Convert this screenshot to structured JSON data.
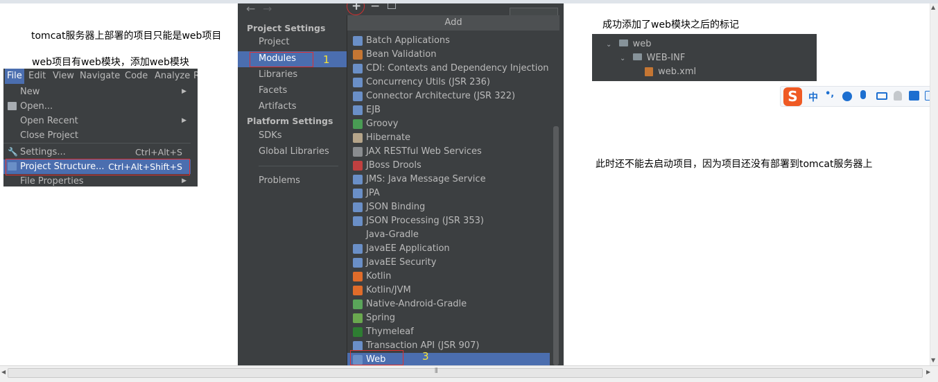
{
  "notes": {
    "line1": "tomcat服务器上部署的项目只能是web项目",
    "line2": "web项目有web模块，添加web模块",
    "right_title": "成功添加了web模块之后的标记",
    "right_note": "此时还不能去启动项目，因为项目还没有部署到tomcat服务器上"
  },
  "menubar": {
    "items": [
      "File",
      "Edit",
      "View",
      "Navigate",
      "Code",
      "Analyze",
      "R"
    ]
  },
  "file_menu": {
    "items": [
      {
        "label": "New",
        "shortcut": "",
        "submenu": true
      },
      {
        "label": "Open...",
        "shortcut": "",
        "submenu": false
      },
      {
        "label": "Open Recent",
        "shortcut": "",
        "submenu": true
      },
      {
        "label": "Close Project",
        "shortcut": "",
        "submenu": false
      },
      {
        "label": "Settings...",
        "shortcut": "Ctrl+Alt+S",
        "submenu": false
      },
      {
        "label": "Project Structure...",
        "shortcut": "Ctrl+Alt+Shift+S",
        "submenu": false
      },
      {
        "label": "File Properties",
        "shortcut": "",
        "submenu": true
      }
    ]
  },
  "project_structure": {
    "project_settings_header": "Project Settings",
    "project_settings": [
      "Project",
      "Modules",
      "Libraries",
      "Facets",
      "Artifacts"
    ],
    "platform_settings_header": "Platform Settings",
    "platform_settings": [
      "SDKs",
      "Global Libraries"
    ],
    "problems": "Problems",
    "add_popup_title": "Add",
    "add_items": [
      "Batch Applications",
      "Bean Validation",
      "CDI: Contexts and Dependency Injection",
      "Concurrency Utils (JSR 236)",
      "Connector Architecture (JSR 322)",
      "EJB",
      "Groovy",
      "Hibernate",
      "JAX RESTful Web Services",
      "JBoss Drools",
      "JMS: Java Message Service",
      "JPA",
      "JSON Binding",
      "JSON Processing (JSR 353)",
      "Java-Gradle",
      "JavaEE Application",
      "JavaEE Security",
      "Kotlin",
      "Kotlin/JVM",
      "Native-Android-Gradle",
      "Spring",
      "Thymeleaf",
      "Transaction API (JSR 907)",
      "Web"
    ],
    "selected_item": "Web",
    "toolbar_add": "+",
    "toolbar_remove": "−"
  },
  "annotations": [
    "1",
    "3"
  ],
  "web_tree": {
    "root": "web",
    "child": "WEB-INF",
    "file": "web.xml"
  },
  "ime": {
    "mode": "中",
    "punct": "•,"
  },
  "colors": {
    "ide_bg": "#3c3f41",
    "selection": "#4b6eaf",
    "annotation": "#f5e33a",
    "highlight_box": "#e03030"
  }
}
